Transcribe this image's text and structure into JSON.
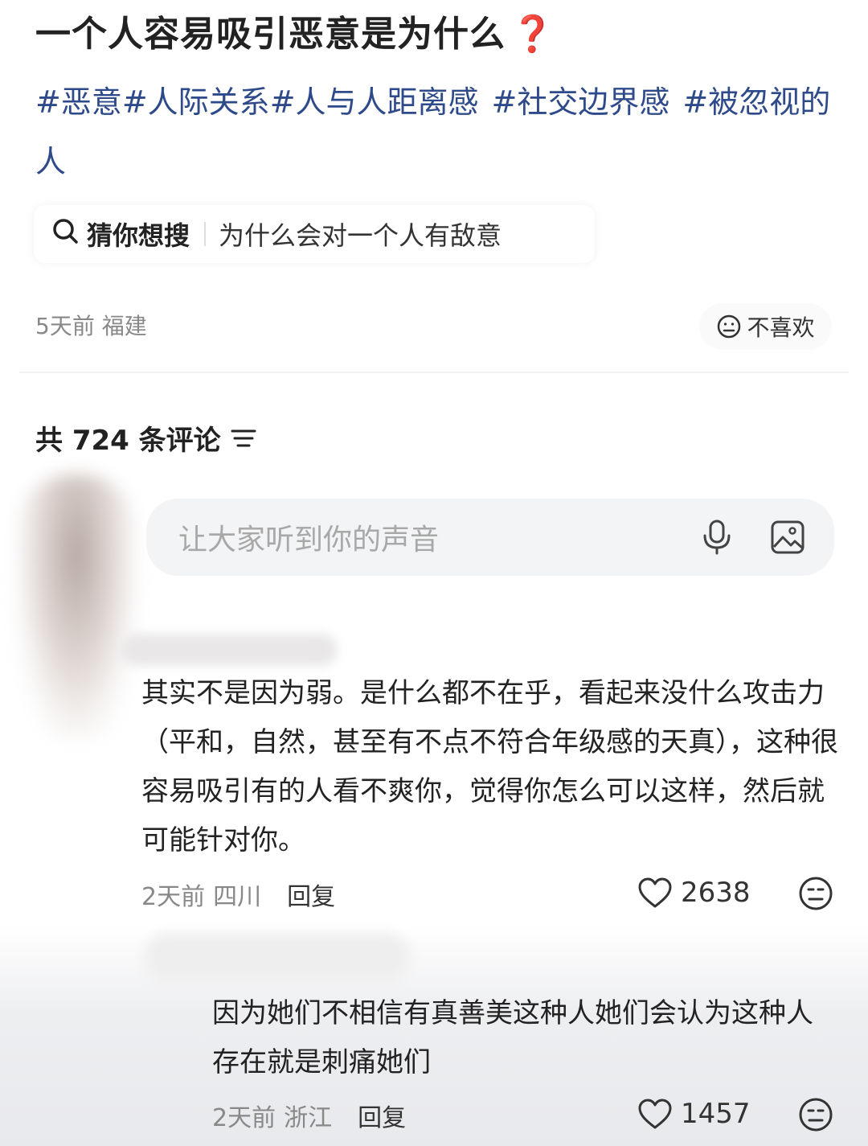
{
  "post": {
    "title": "一个人容易吸引恶意是为什么",
    "title_emoji": "❓",
    "tags": [
      "#恶意",
      "#人际关系",
      "#人与人距离感",
      "#社交边界感",
      "#被忽视的人"
    ],
    "meta": "5天前 福建",
    "dislike_label": "不喜欢"
  },
  "guess_search": {
    "label": "猜你想搜",
    "query": "为什么会对一个人有敌意"
  },
  "comments_header": {
    "count_text": "共 724 条评论"
  },
  "comment_input": {
    "placeholder": "让大家听到你的声音"
  },
  "comments": [
    {
      "text": "其实不是因为弱。是什么都不在乎，看起来没什么攻击力（平和，自然，甚至有不点不符合年级感的天真），这种很容易吸引有的人看不爽你，觉得你怎么可以这样，然后就可能针对你。",
      "time": "2天前",
      "location": "四川",
      "reply_label": "回复",
      "likes": "2638"
    },
    {
      "text": "因为她们不相信有真善美这种人她们会认为这种人存在就是刺痛她们",
      "time": "2天前",
      "location": "浙江",
      "reply_label": "回复",
      "likes": "1457"
    }
  ]
}
